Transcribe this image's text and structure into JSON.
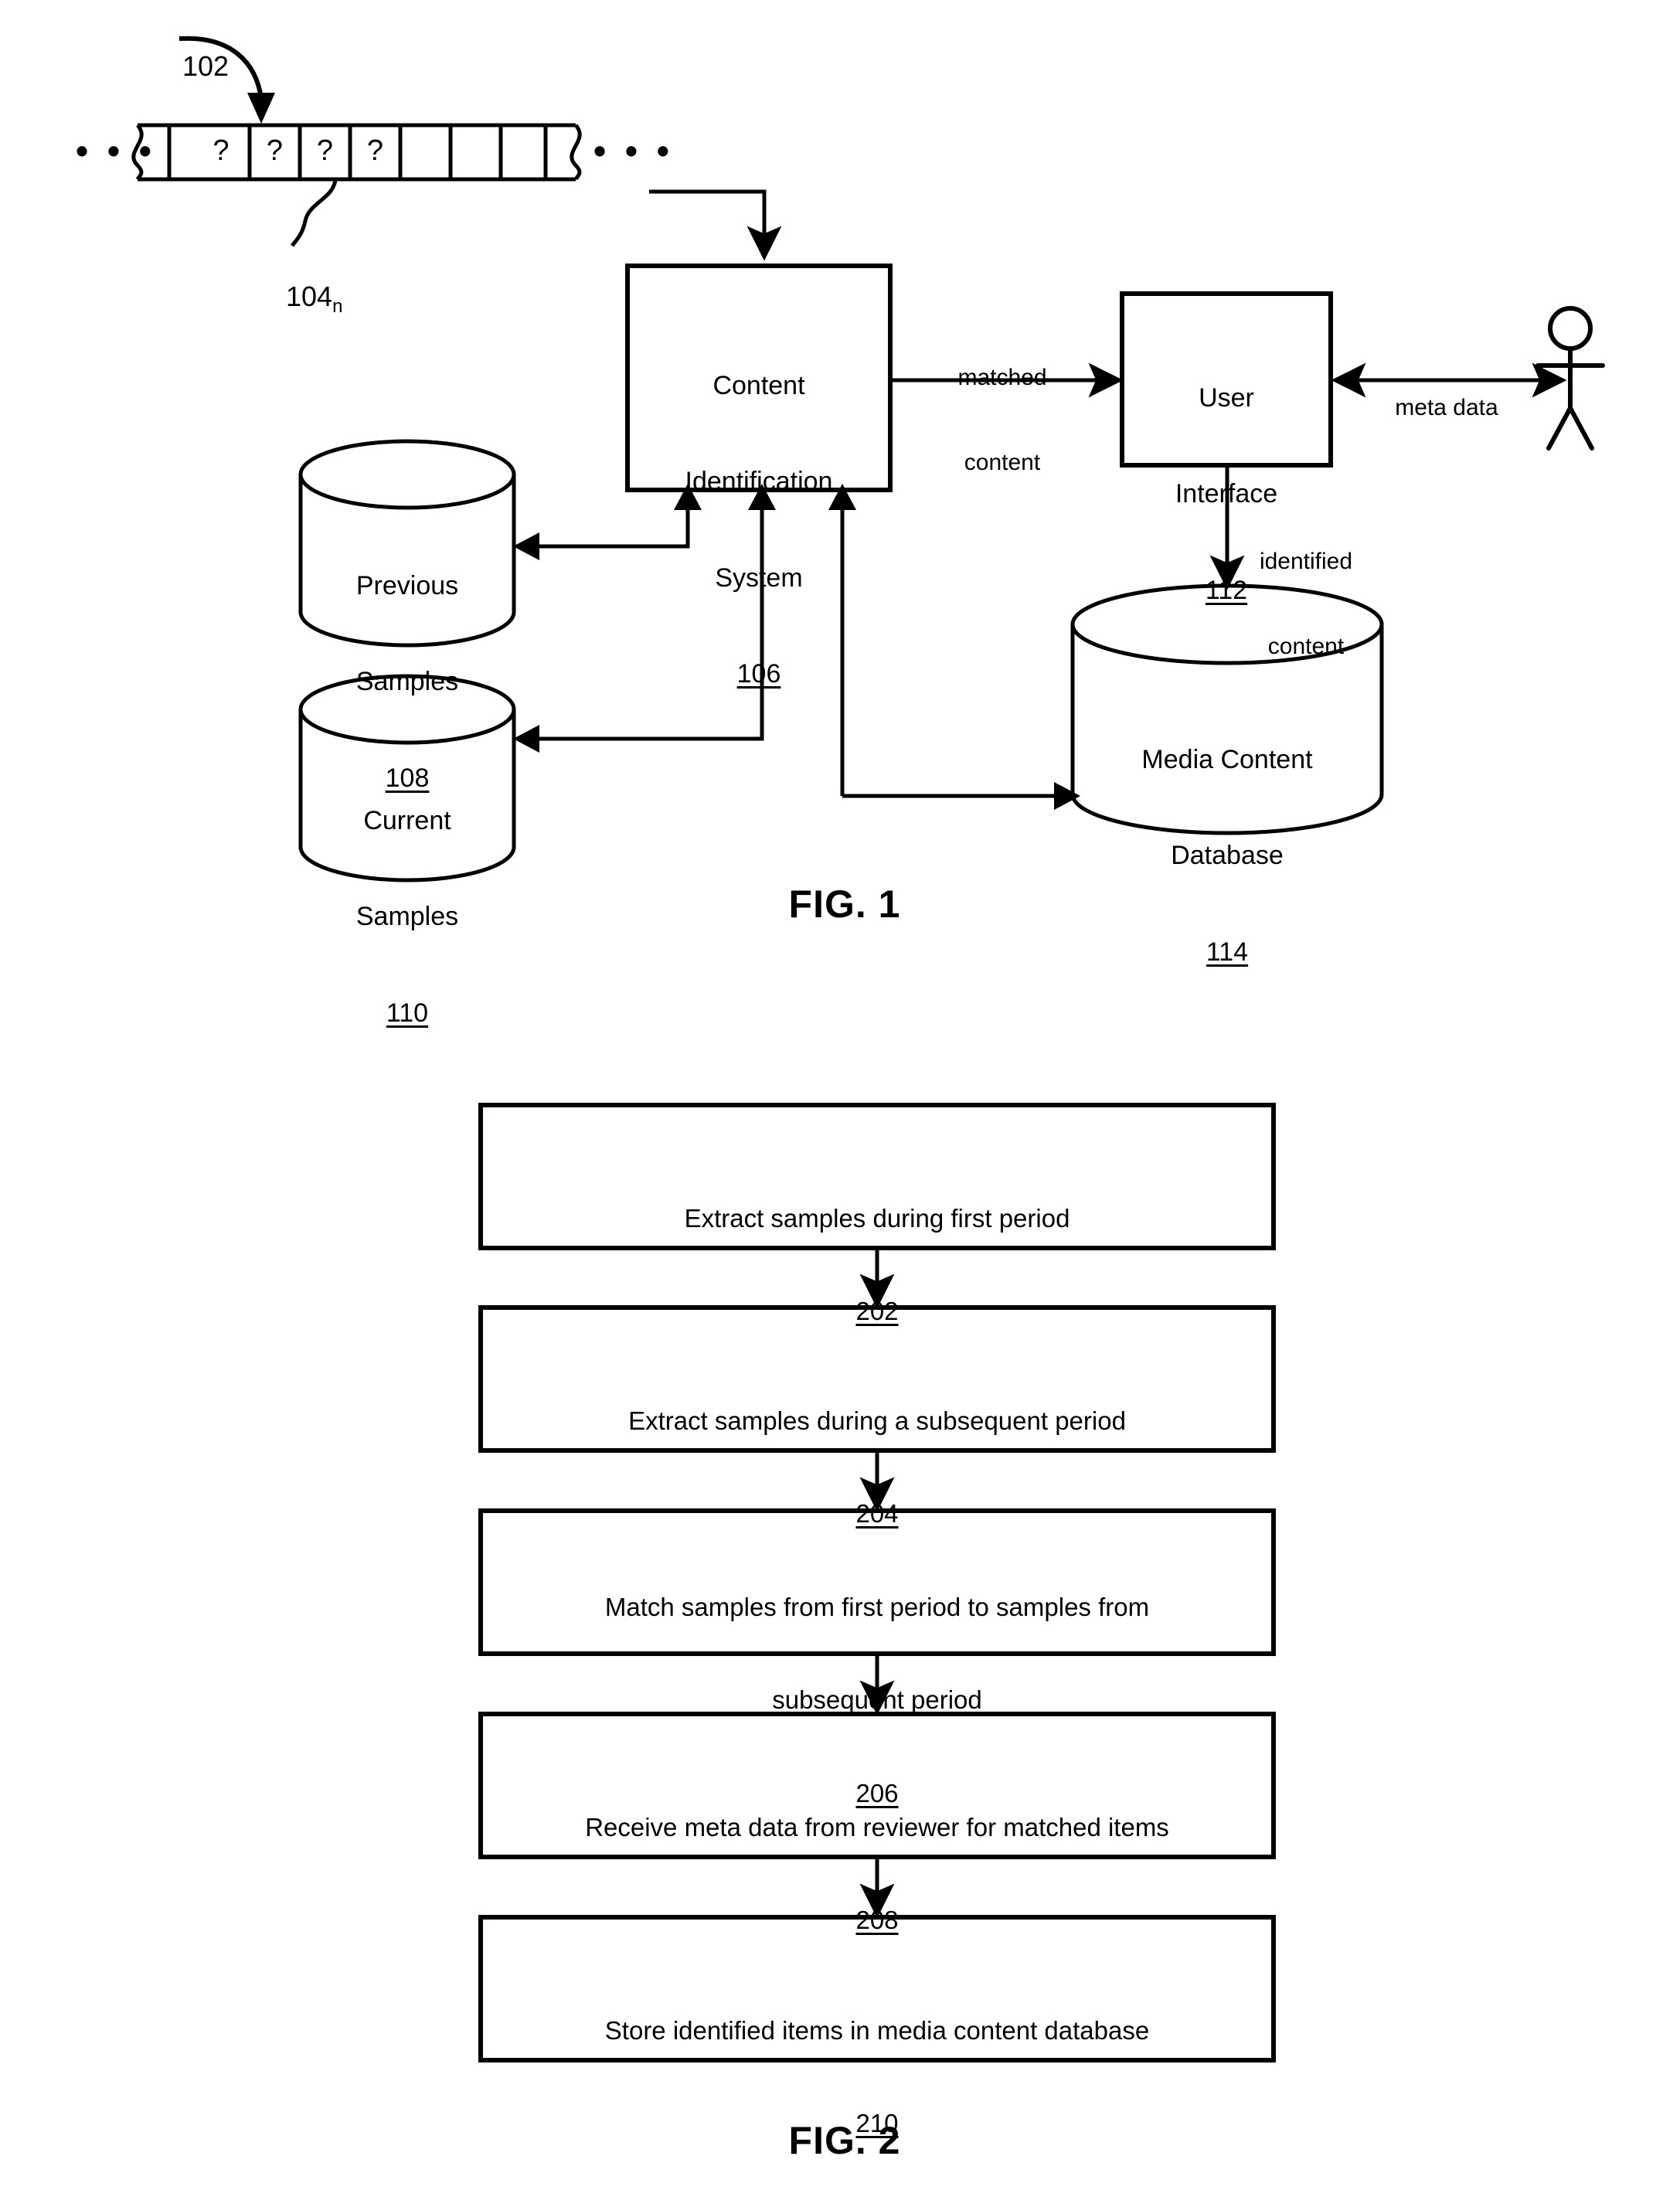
{
  "document": {
    "type": "patent-figure-sheet",
    "figures": [
      "FIG. 1",
      "FIG. 2"
    ]
  },
  "fig1": {
    "caption": "FIG. 1",
    "stream": {
      "lead_label": "102",
      "sample_lead_label": "104",
      "sample_lead_subscript": "n",
      "left_ellipsis": "• • •",
      "right_ellipsis": "• • •",
      "cells": [
        "?",
        "?",
        "?",
        "?"
      ]
    },
    "nodes": {
      "content_identification_system": {
        "line1": "Content",
        "line2": "Identification",
        "line3": "System",
        "ref": "106"
      },
      "user_interface": {
        "line1": "User",
        "line2": "Interface",
        "ref": "112"
      },
      "previous_samples": {
        "line1": "Previous",
        "line2": "Samples",
        "ref": "108"
      },
      "current_samples": {
        "line1": "Current",
        "line2": "Samples",
        "ref": "110"
      },
      "media_content_database": {
        "line1": "Media Content",
        "line2": "Database",
        "ref": "114"
      },
      "actor": {
        "name": "reviewer-stick-figure"
      }
    },
    "edges": {
      "matched_content": {
        "line1": "matched",
        "line2": "content"
      },
      "meta_data": {
        "line1": "meta data"
      },
      "identified_content": {
        "line1": "identified",
        "line2": "content"
      }
    }
  },
  "fig2": {
    "caption": "FIG. 2",
    "steps": [
      {
        "text": "Extract samples during first period",
        "ref": "202"
      },
      {
        "text": "Extract samples during a subsequent period",
        "ref": "204"
      },
      {
        "text_line1": "Match samples from first period to samples from",
        "text_line2": "subsequent period",
        "ref": "206"
      },
      {
        "text": "Receive meta data from reviewer for matched items",
        "ref": "208"
      },
      {
        "text": "Store identified items in media content database",
        "ref": "210"
      }
    ]
  },
  "colors": {
    "ink": "#000000",
    "paper": "#ffffff"
  }
}
